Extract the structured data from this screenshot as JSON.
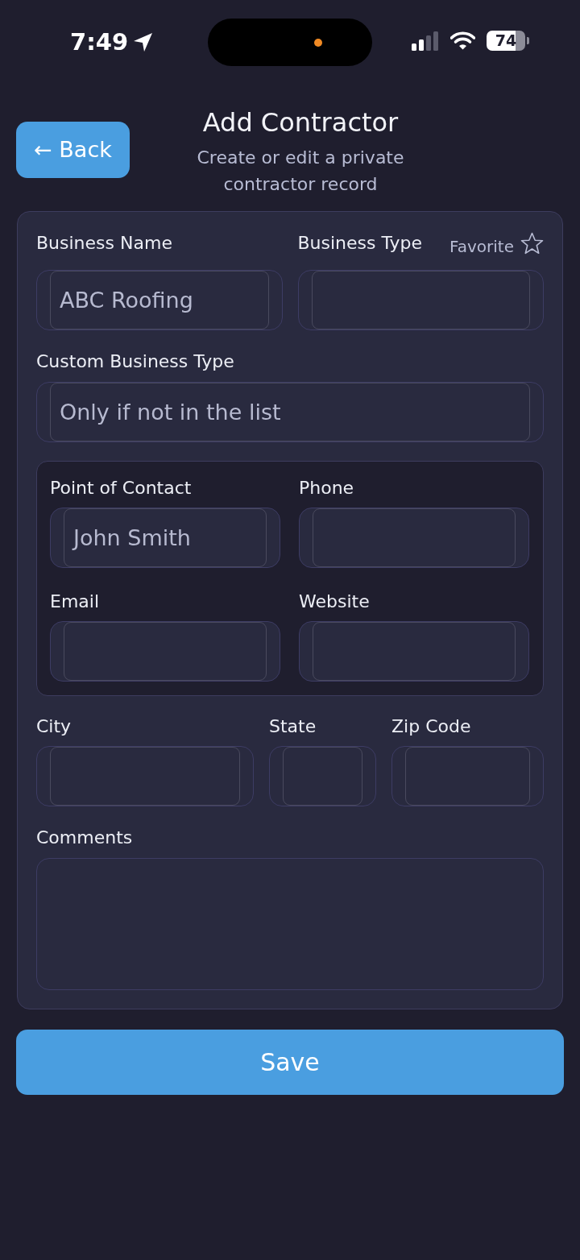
{
  "status_bar": {
    "time": "7:49",
    "battery": "74"
  },
  "header": {
    "back_button": "← Back",
    "title": "Add Contractor",
    "subtitle": "Create or edit a private contractor record"
  },
  "business": {
    "name": {
      "label": "Business Name",
      "placeholder": "ABC Roofing"
    },
    "type": {
      "label": "Business Type"
    },
    "favorite": {
      "label": "Favorite",
      "on": false
    },
    "custom_type": {
      "label": "Custom Business Type",
      "placeholder": "Only if not in the list"
    }
  },
  "contact": [
    {
      "label": "Point of Contact",
      "placeholder": "John Smith"
    },
    {
      "label": "Phone"
    },
    {
      "label": "Email"
    },
    {
      "label": "Website"
    }
  ],
  "address": [
    {
      "label": "City"
    },
    {
      "label": "State"
    },
    {
      "label": "Zip Code"
    }
  ],
  "comments": {
    "label": "Comments"
  },
  "save_button": "Save"
}
